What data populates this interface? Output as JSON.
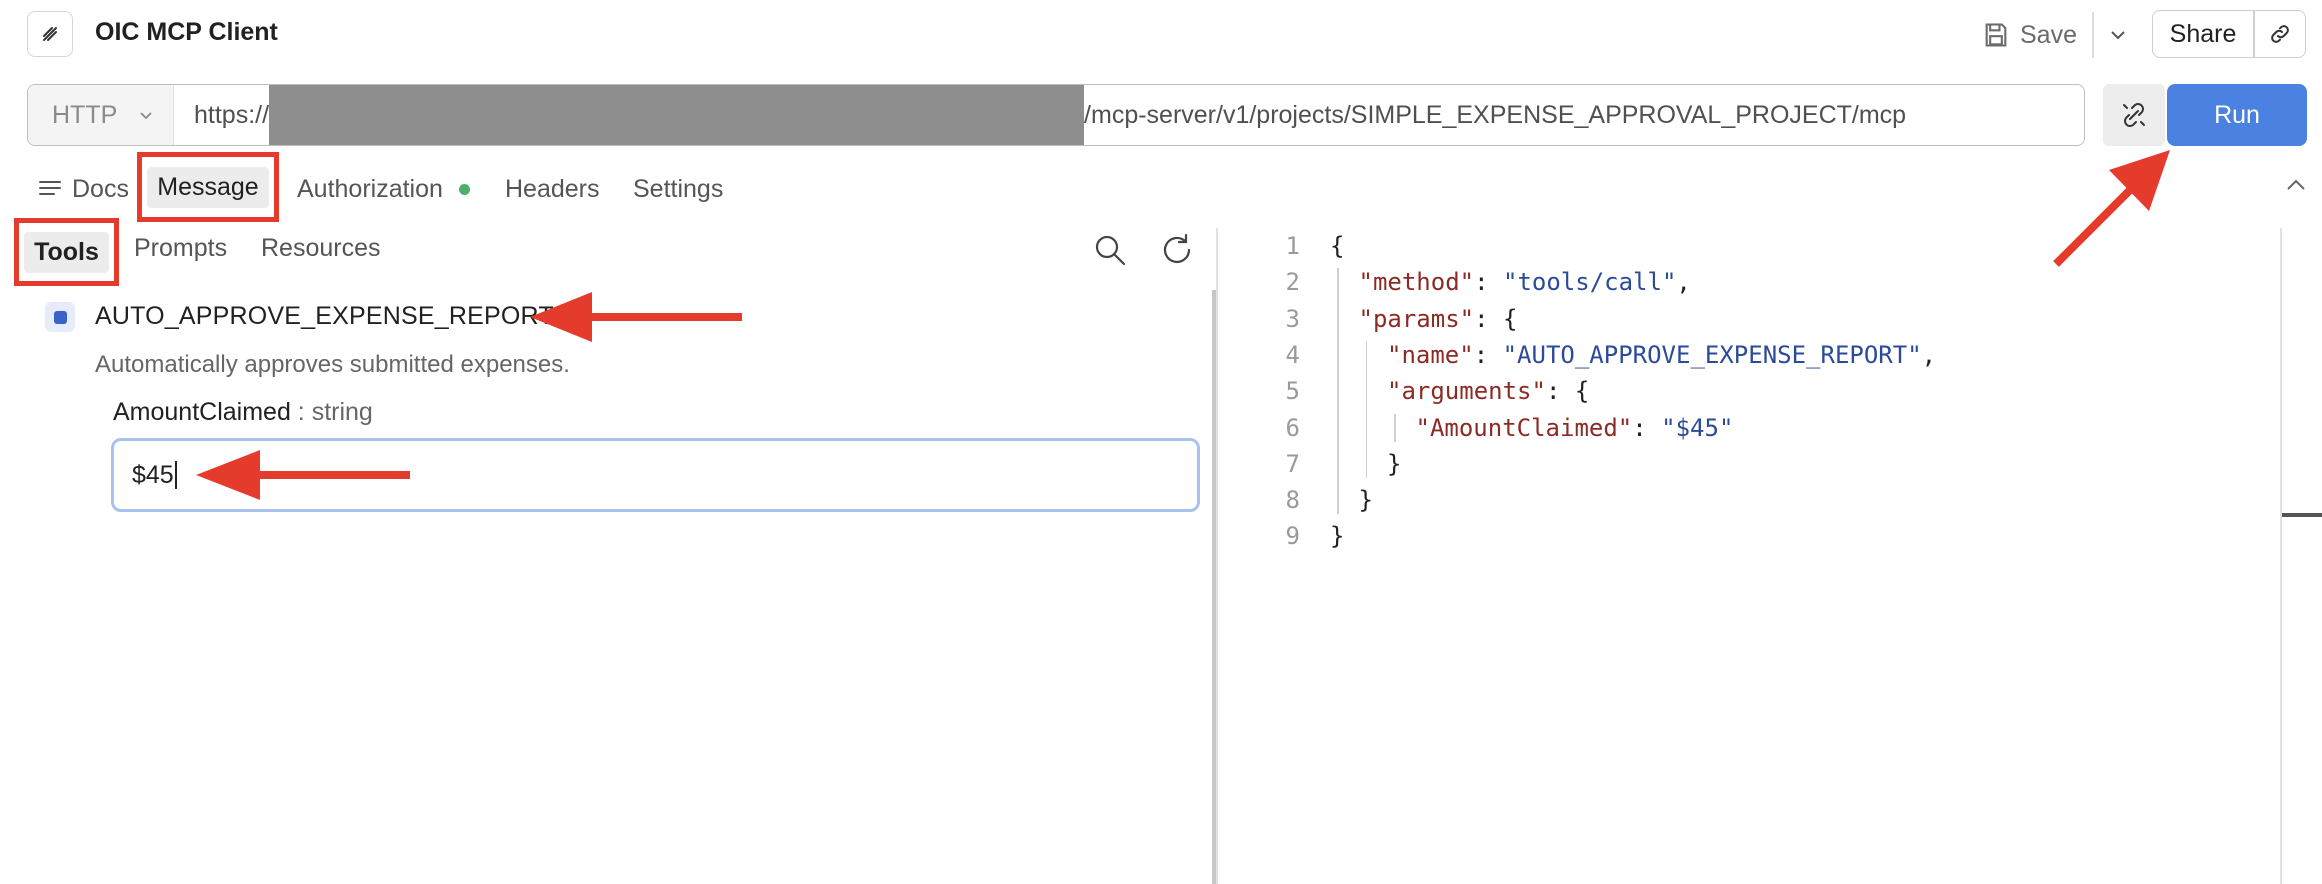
{
  "header": {
    "title": "OIC MCP Client",
    "save_label": "Save",
    "share_label": "Share"
  },
  "request": {
    "method": "HTTP",
    "url_prefix": "https://",
    "url_suffix": "/mcp-server/v1/projects/SIMPLE_EXPENSE_APPROVAL_PROJECT/mcp",
    "run_label": "Run"
  },
  "tabs": {
    "docs": "Docs",
    "message": "Message",
    "authorization": "Authorization",
    "headers": "Headers",
    "settings": "Settings"
  },
  "subtabs": {
    "tools": "Tools",
    "prompts": "Prompts",
    "resources": "Resources"
  },
  "tool": {
    "name": "AUTO_APPROVE_EXPENSE_REPORT",
    "description": "Automatically approves submitted expenses.",
    "param_name": "AmountClaimed",
    "param_type": " : string",
    "param_value": "$45"
  },
  "code_lines": [
    {
      "num": "1",
      "parts": [
        "{"
      ]
    },
    {
      "num": "2",
      "key": "\"method\"",
      "colon": ": ",
      "value": "\"tools/call\"",
      "tail": ","
    },
    {
      "num": "3",
      "key": "\"params\"",
      "colon": ": ",
      "tail": "{"
    },
    {
      "num": "4",
      "key": "\"name\"",
      "colon": ": ",
      "value": "\"AUTO_APPROVE_EXPENSE_REPORT\"",
      "tail": ","
    },
    {
      "num": "5",
      "key": "\"arguments\"",
      "colon": ": ",
      "tail": "{"
    },
    {
      "num": "6",
      "key": "\"AmountClaimed\"",
      "colon": ": ",
      "value": "\"$45\""
    },
    {
      "num": "7",
      "tail": "}"
    },
    {
      "num": "8",
      "tail": "}"
    },
    {
      "num": "9",
      "tail": "}"
    }
  ],
  "colors": {
    "accent": "#4b81e0",
    "annotation_red": "#e53b2c",
    "auth_status": "#4caf6a"
  }
}
